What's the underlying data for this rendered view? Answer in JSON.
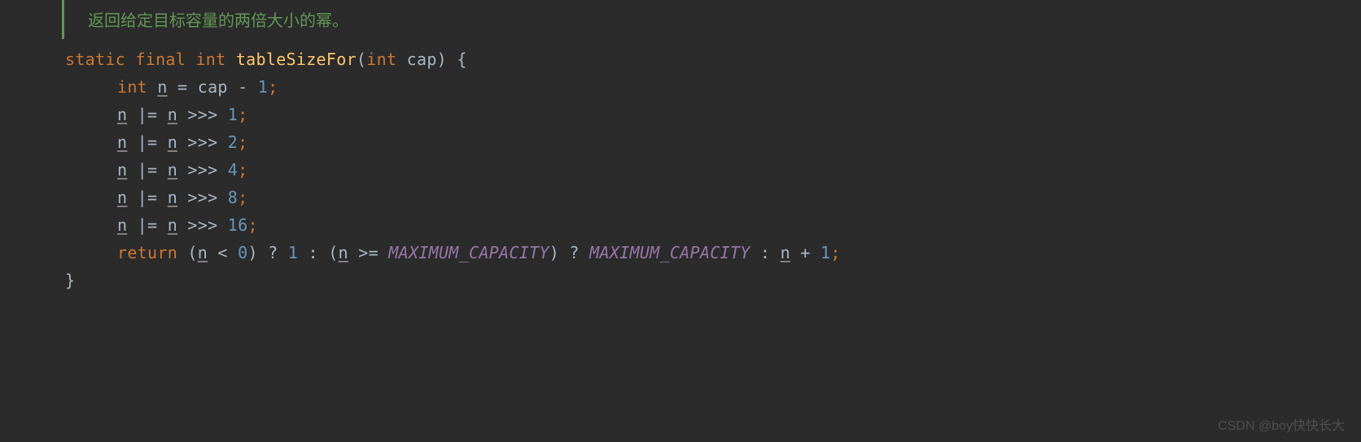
{
  "comment": "返回给定目标容量的两倍大小的幂。",
  "code": {
    "sig": {
      "k1": "static",
      "k2": "final",
      "k3": "int",
      "method": "tableSizeFor",
      "lparen": "(",
      "pkw": "int",
      "pname": " cap",
      "rparen": ")",
      "brace": " {"
    },
    "l1": {
      "kw": "int",
      "var": "n",
      "rest": " = cap - ",
      "num": "1",
      "semi": ";"
    },
    "l2": {
      "n1": "n",
      "mid": " |= ",
      "n2": "n",
      "op": " >>> ",
      "num": "1",
      "semi": ";"
    },
    "l3": {
      "n1": "n",
      "mid": " |= ",
      "n2": "n",
      "op": " >>> ",
      "num": "2",
      "semi": ";"
    },
    "l4": {
      "n1": "n",
      "mid": " |= ",
      "n2": "n",
      "op": " >>> ",
      "num": "4",
      "semi": ";"
    },
    "l5": {
      "n1": "n",
      "mid": " |= ",
      "n2": "n",
      "op": " >>> ",
      "num": "8",
      "semi": ";"
    },
    "l6": {
      "n1": "n",
      "mid": " |= ",
      "n2": "n",
      "op": " >>> ",
      "num": "16",
      "semi": ";"
    },
    "ret": {
      "kw": "return",
      "p1": " (",
      "n1": "n",
      "cmp1": " < ",
      "zero": "0",
      "p2": ") ? ",
      "one": "1",
      "p3": " : (",
      "n2": "n",
      "cmp2": " >= ",
      "c1": "MAXIMUM_CAPACITY",
      "p4": ") ? ",
      "c2": "MAXIMUM_CAPACITY",
      "p5": " : ",
      "n3": "n",
      "plus": " + ",
      "one2": "1",
      "semi": ";"
    },
    "close": "}"
  },
  "watermark": "CSDN @boy快快长大"
}
